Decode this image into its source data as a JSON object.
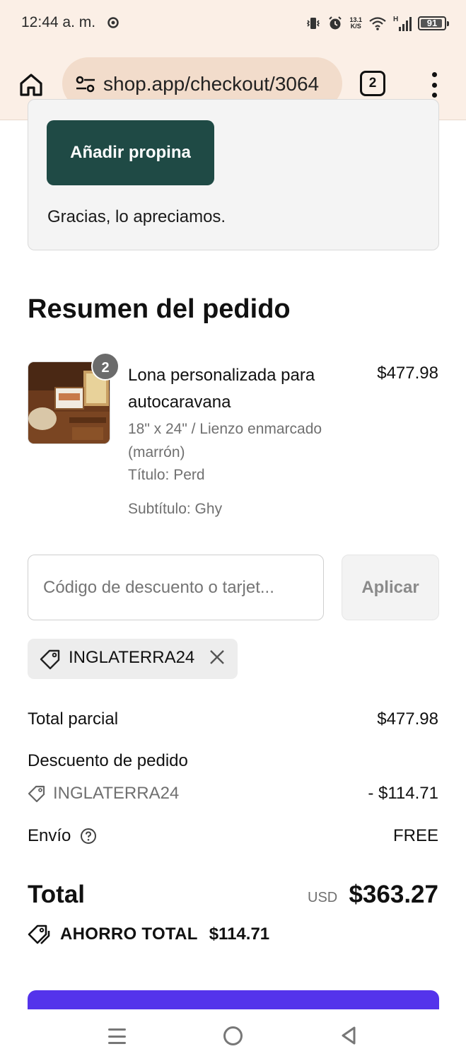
{
  "status_bar": {
    "time": "12:44 a. m.",
    "net_speed_value": "13.1",
    "net_speed_unit": "K/S",
    "signal_label": "H",
    "battery": "91"
  },
  "browser": {
    "url": "shop.app/checkout/3064",
    "tab_count": "2"
  },
  "tip": {
    "button_label": "Añadir propina",
    "thanks_text": "Gracias, lo apreciamos."
  },
  "summary": {
    "title": "Resumen del pedido",
    "product": {
      "quantity": "2",
      "name": "Lona personalizada para autocaravana",
      "price": "$477.98",
      "variant": "18\" x 24\" / Lienzo enmarcado (marrón)",
      "title_option": "Título: Perd",
      "subtitle_option": "Subtítulo: Ghy"
    },
    "discount_field": {
      "placeholder": "Código de descuento o tarjet...",
      "apply_label": "Aplicar"
    },
    "applied_code": "INGLATERRA24",
    "rows": {
      "subtotal_label": "Total parcial",
      "subtotal_value": "$477.98",
      "discount_label": "Descuento de pedido",
      "discount_code": "INGLATERRA24",
      "discount_value": "- $114.71",
      "shipping_label": "Envío",
      "shipping_value": "FREE"
    },
    "total": {
      "label": "Total",
      "currency": "USD",
      "value": "$363.27"
    },
    "savings": {
      "label": "AHORRO TOTAL",
      "value": "$114.71"
    }
  },
  "colors": {
    "tip_button": "#1f4a45",
    "pay_button": "#5433eb",
    "browser_chrome": "#fbefe6",
    "url_pill": "#f2dccb"
  }
}
